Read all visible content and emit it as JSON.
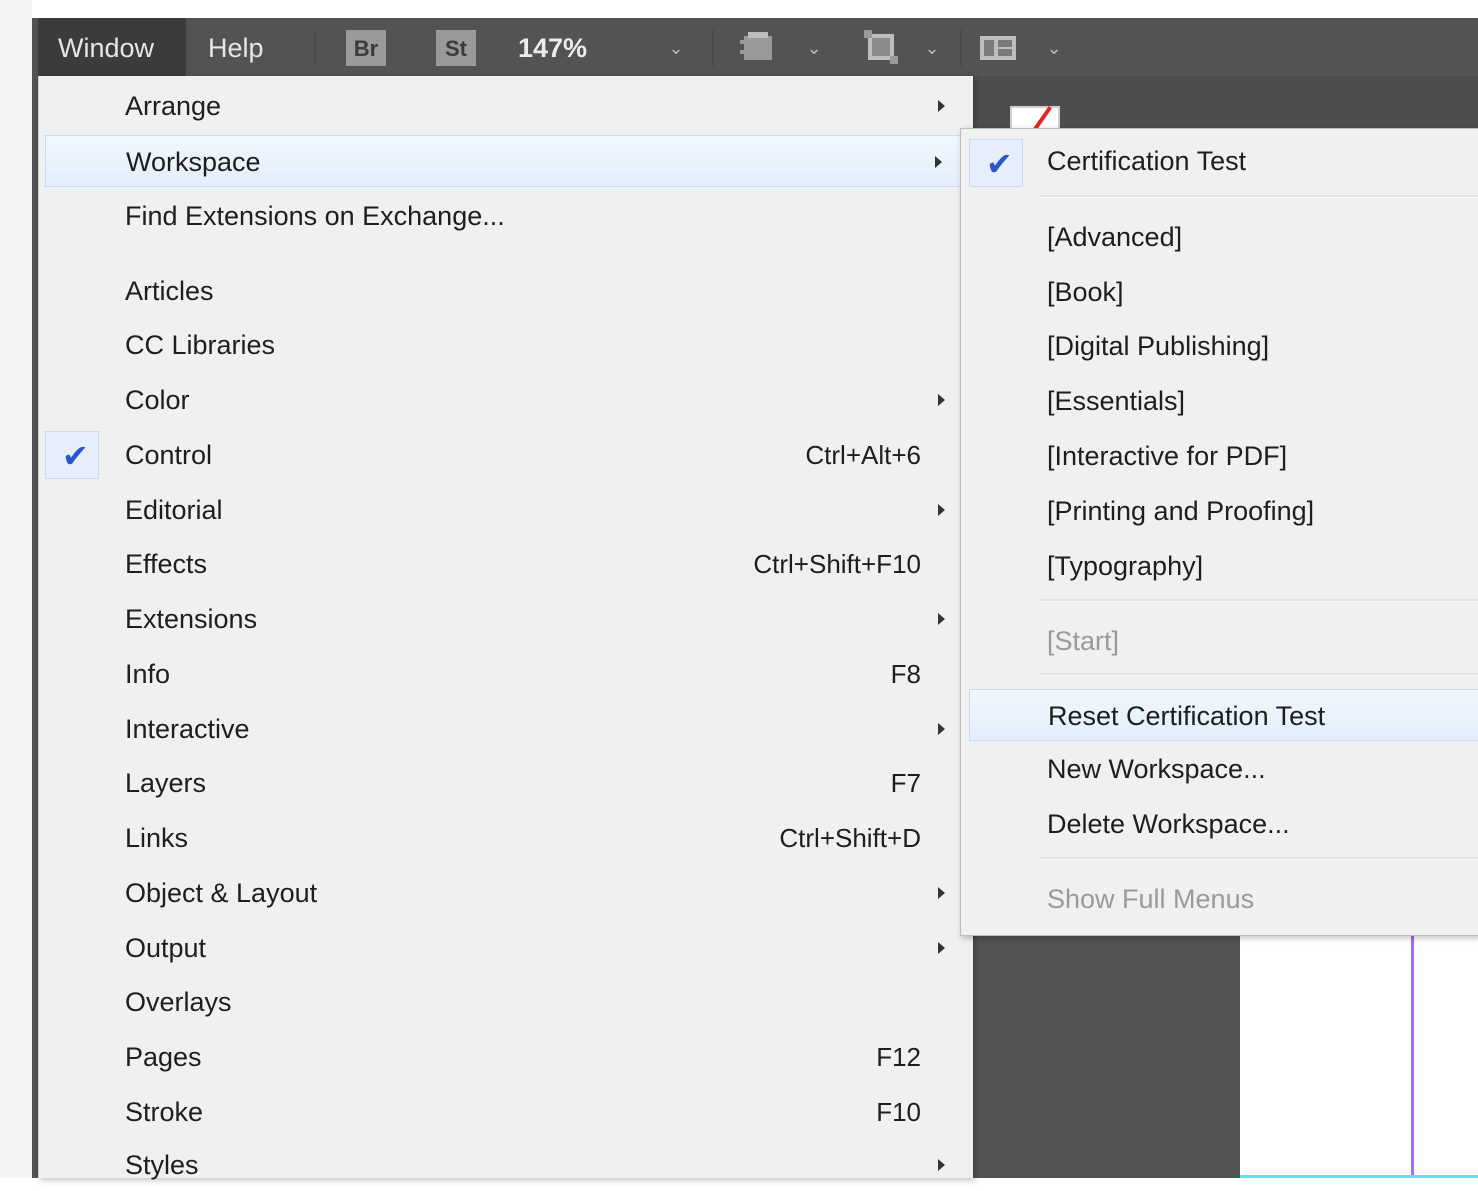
{
  "menubar": {
    "window_label": "Window",
    "help_label": "Help",
    "bridge_badge": "Br",
    "stock_badge": "St",
    "zoom_level": "147%",
    "icons": [
      "chevron-down-icon",
      "screen-mode-icon",
      "frame-icon",
      "arrange-documents-icon"
    ]
  },
  "window_menu": {
    "items": [
      {
        "label": "Arrange",
        "shortcut": "",
        "submenu": true,
        "checked": false,
        "highlighted": false
      },
      {
        "label": "Workspace",
        "shortcut": "",
        "submenu": true,
        "checked": false,
        "highlighted": true
      },
      {
        "label": "Find Extensions on Exchange...",
        "shortcut": "",
        "submenu": false,
        "checked": false,
        "highlighted": false
      },
      {
        "label": "Articles",
        "shortcut": "",
        "submenu": false,
        "checked": false,
        "highlighted": false
      },
      {
        "label": "CC Libraries",
        "shortcut": "",
        "submenu": false,
        "checked": false,
        "highlighted": false
      },
      {
        "label": "Color",
        "shortcut": "",
        "submenu": true,
        "checked": false,
        "highlighted": false
      },
      {
        "label": "Control",
        "shortcut": "Ctrl+Alt+6",
        "submenu": false,
        "checked": true,
        "highlighted": false
      },
      {
        "label": "Editorial",
        "shortcut": "",
        "submenu": true,
        "checked": false,
        "highlighted": false
      },
      {
        "label": "Effects",
        "shortcut": "Ctrl+Shift+F10",
        "submenu": false,
        "checked": false,
        "highlighted": false
      },
      {
        "label": "Extensions",
        "shortcut": "",
        "submenu": true,
        "checked": false,
        "highlighted": false
      },
      {
        "label": "Info",
        "shortcut": "F8",
        "submenu": false,
        "checked": false,
        "highlighted": false
      },
      {
        "label": "Interactive",
        "shortcut": "",
        "submenu": true,
        "checked": false,
        "highlighted": false
      },
      {
        "label": "Layers",
        "shortcut": "F7",
        "submenu": false,
        "checked": false,
        "highlighted": false
      },
      {
        "label": "Links",
        "shortcut": "Ctrl+Shift+D",
        "submenu": false,
        "checked": false,
        "highlighted": false
      },
      {
        "label": "Object & Layout",
        "shortcut": "",
        "submenu": true,
        "checked": false,
        "highlighted": false
      },
      {
        "label": "Output",
        "shortcut": "",
        "submenu": true,
        "checked": false,
        "highlighted": false
      },
      {
        "label": "Overlays",
        "shortcut": "",
        "submenu": false,
        "checked": false,
        "highlighted": false
      },
      {
        "label": "Pages",
        "shortcut": "F12",
        "submenu": false,
        "checked": false,
        "highlighted": false
      },
      {
        "label": "Stroke",
        "shortcut": "F10",
        "submenu": false,
        "checked": false,
        "highlighted": false
      },
      {
        "label": "Styles",
        "shortcut": "",
        "submenu": true,
        "checked": false,
        "highlighted": false
      }
    ]
  },
  "workspace_submenu": {
    "items": [
      {
        "label": "Certification Test",
        "checked": true,
        "disabled": false,
        "highlighted": false
      },
      {
        "label": "[Advanced]",
        "checked": false,
        "disabled": false,
        "highlighted": false
      },
      {
        "label": "[Book]",
        "checked": false,
        "disabled": false,
        "highlighted": false
      },
      {
        "label": "[Digital Publishing]",
        "checked": false,
        "disabled": false,
        "highlighted": false
      },
      {
        "label": "[Essentials]",
        "checked": false,
        "disabled": false,
        "highlighted": false
      },
      {
        "label": "[Interactive for PDF]",
        "checked": false,
        "disabled": false,
        "highlighted": false
      },
      {
        "label": "[Printing and Proofing]",
        "checked": false,
        "disabled": false,
        "highlighted": false
      },
      {
        "label": "[Typography]",
        "checked": false,
        "disabled": false,
        "highlighted": false
      },
      {
        "label": "[Start]",
        "checked": false,
        "disabled": true,
        "highlighted": false
      },
      {
        "label": "Reset Certification Test",
        "checked": false,
        "disabled": false,
        "highlighted": true
      },
      {
        "label": "New Workspace...",
        "checked": false,
        "disabled": false,
        "highlighted": false
      },
      {
        "label": "Delete Workspace...",
        "checked": false,
        "disabled": false,
        "highlighted": false
      },
      {
        "label": "Show Full Menus",
        "checked": false,
        "disabled": true,
        "highlighted": false
      }
    ]
  },
  "colors": {
    "app_background": "#535353",
    "menu_background": "#f0f0f0",
    "highlight_border": "#c6daf3",
    "checkmark": "#2a56c9",
    "guide_purple": "#a36bff"
  }
}
